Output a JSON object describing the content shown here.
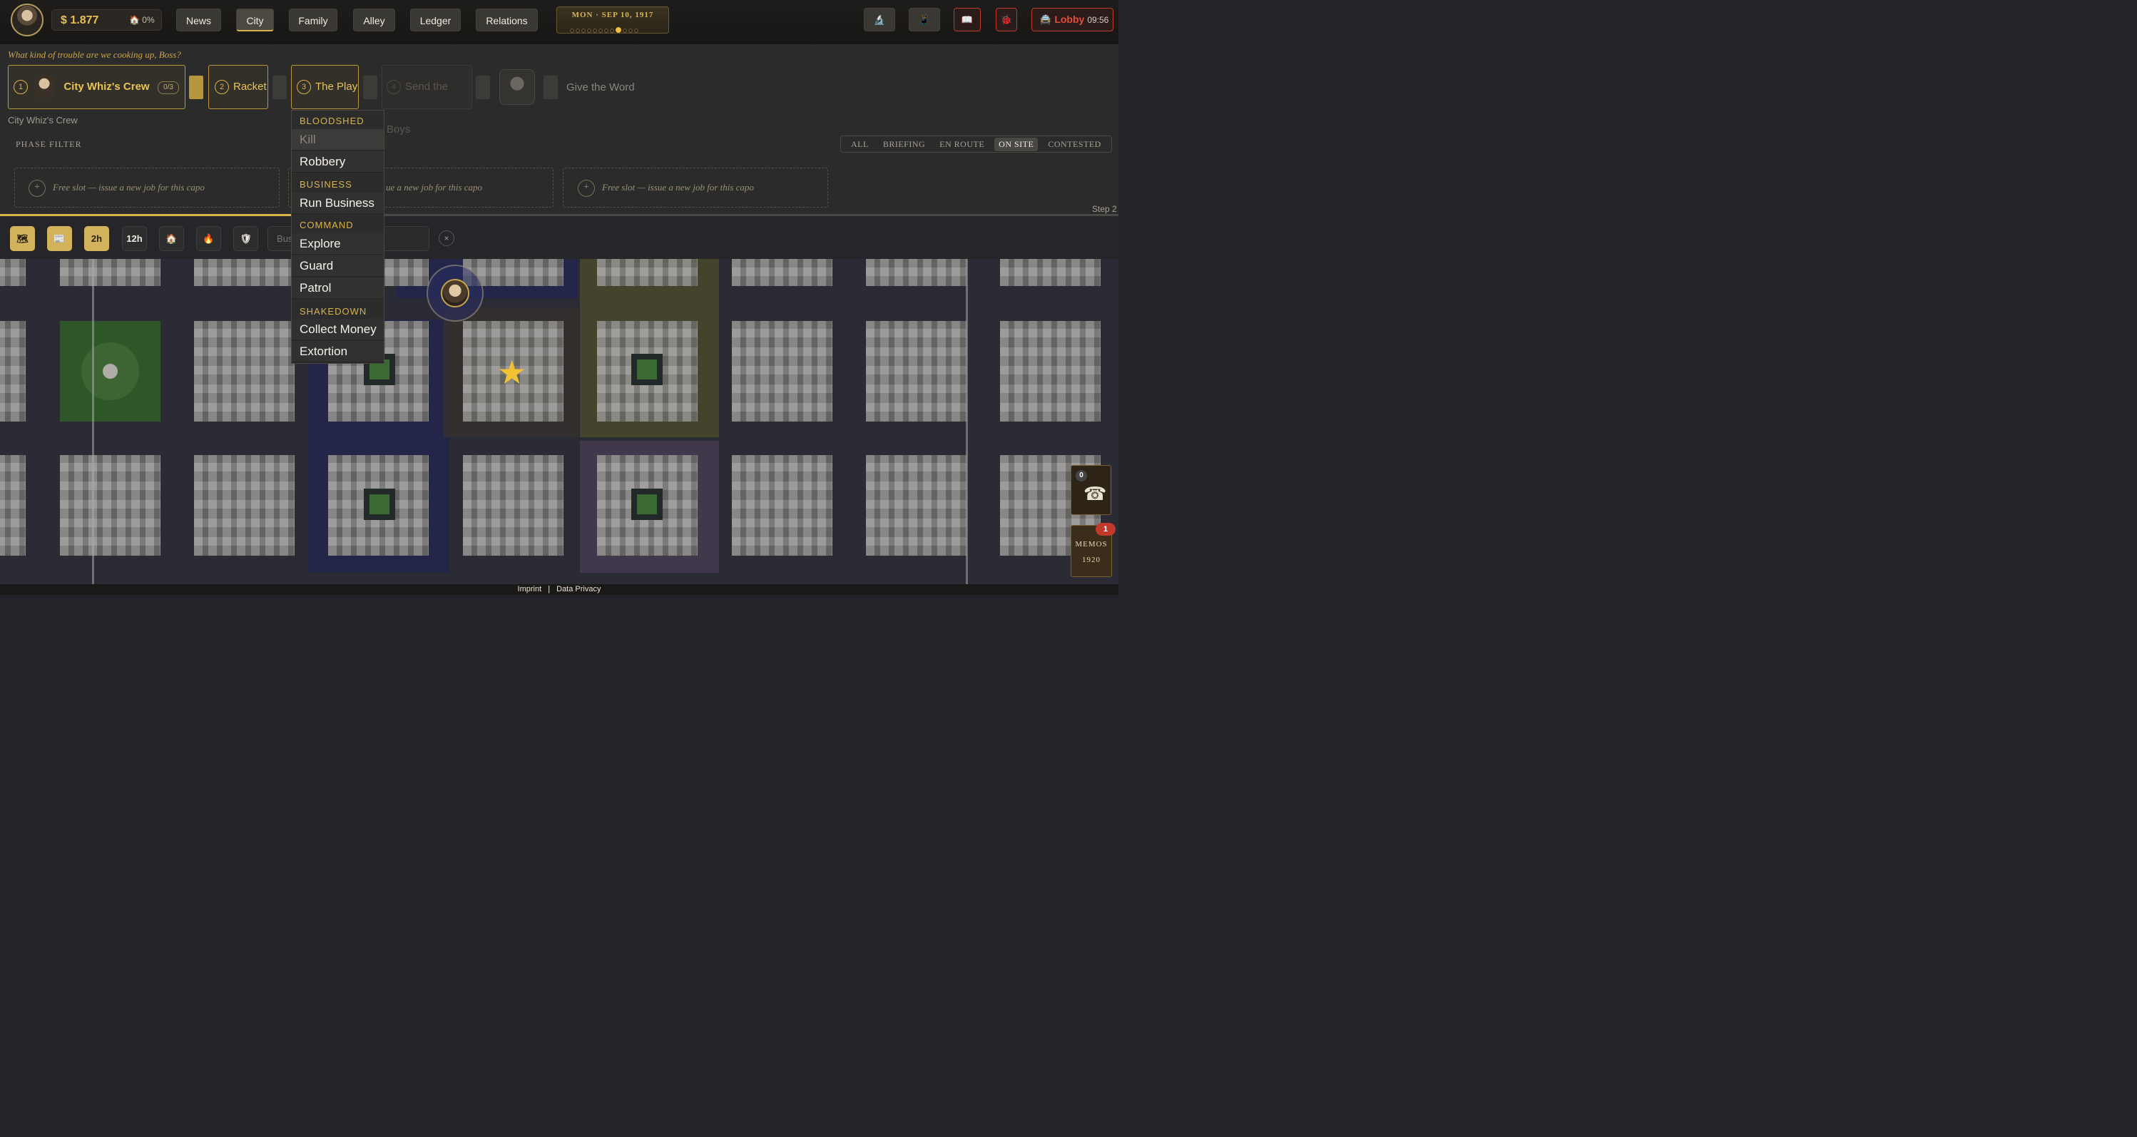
{
  "topbar": {
    "money": "$ 1.877",
    "heat": "🏠 0%",
    "nav": [
      {
        "label": "News"
      },
      {
        "label": "City",
        "active": true
      },
      {
        "label": "Family"
      },
      {
        "label": "Alley"
      },
      {
        "label": "Ledger"
      },
      {
        "label": "Relations"
      }
    ],
    "date": "MON · SEP 10, 1917",
    "date_progress": {
      "total": 12,
      "current": 9
    },
    "icons": [
      "microscope-icon",
      "phone-icon",
      "book-icon",
      "bug-icon"
    ],
    "lobby_label": "Lobby",
    "lobby_icon": "🚔",
    "lobby_time": "09:56"
  },
  "planning": {
    "prompt": "What kind of trouble are we cooking up, Boss?",
    "steps": [
      {
        "num": "1",
        "label": "City Whiz's Crew",
        "count": "0/3"
      },
      {
        "num": "2",
        "label": "Racket"
      },
      {
        "num": "3",
        "label": "The Play"
      },
      {
        "num": "4",
        "label": "Send the Boys"
      },
      {
        "label": "Give the Word"
      }
    ],
    "crew_subtitle": "City Whiz's Crew",
    "phase_filter_label": "PHASE FILTER",
    "phase_filters": [
      {
        "label": "ALL"
      },
      {
        "label": "BRIEFING"
      },
      {
        "label": "EN ROUTE"
      },
      {
        "label": "ON SITE",
        "active": true
      },
      {
        "label": "CONTESTED"
      }
    ],
    "free_slot_text": "Free slot — issue a new job for this capo",
    "free_slot_partial": "ue a new job for this capo",
    "step_label": "Step 2",
    "progress": 0.26
  },
  "dropdown": {
    "groups": [
      {
        "header": "BLOODSHED",
        "items": [
          "Kill",
          "Robbery"
        ]
      },
      {
        "header": "BUSINESS",
        "items": [
          "Run Business"
        ]
      },
      {
        "header": "COMMAND",
        "items": [
          "Explore",
          "Guard",
          "Patrol"
        ]
      },
      {
        "header": "SHAKEDOWN",
        "items": [
          "Collect Money",
          "Extortion"
        ]
      }
    ]
  },
  "toolbar": {
    "buttons": [
      "map-icon",
      "newspaper-icon",
      "2h",
      "12h",
      "house-icon",
      "fire-icon",
      "shield-icon"
    ],
    "search_placeholder": "Bus",
    "clear": "×"
  },
  "widgets": {
    "phone_count": "0",
    "memos_title": "MEMOS",
    "memos_year": "1920",
    "memos_badge": "1"
  },
  "footer": {
    "imprint": "Imprint",
    "separator": "|",
    "privacy": "Data Privacy"
  },
  "colors": {
    "accent": "#d8b24a",
    "danger": "#c0392b",
    "background": "#24232a"
  }
}
